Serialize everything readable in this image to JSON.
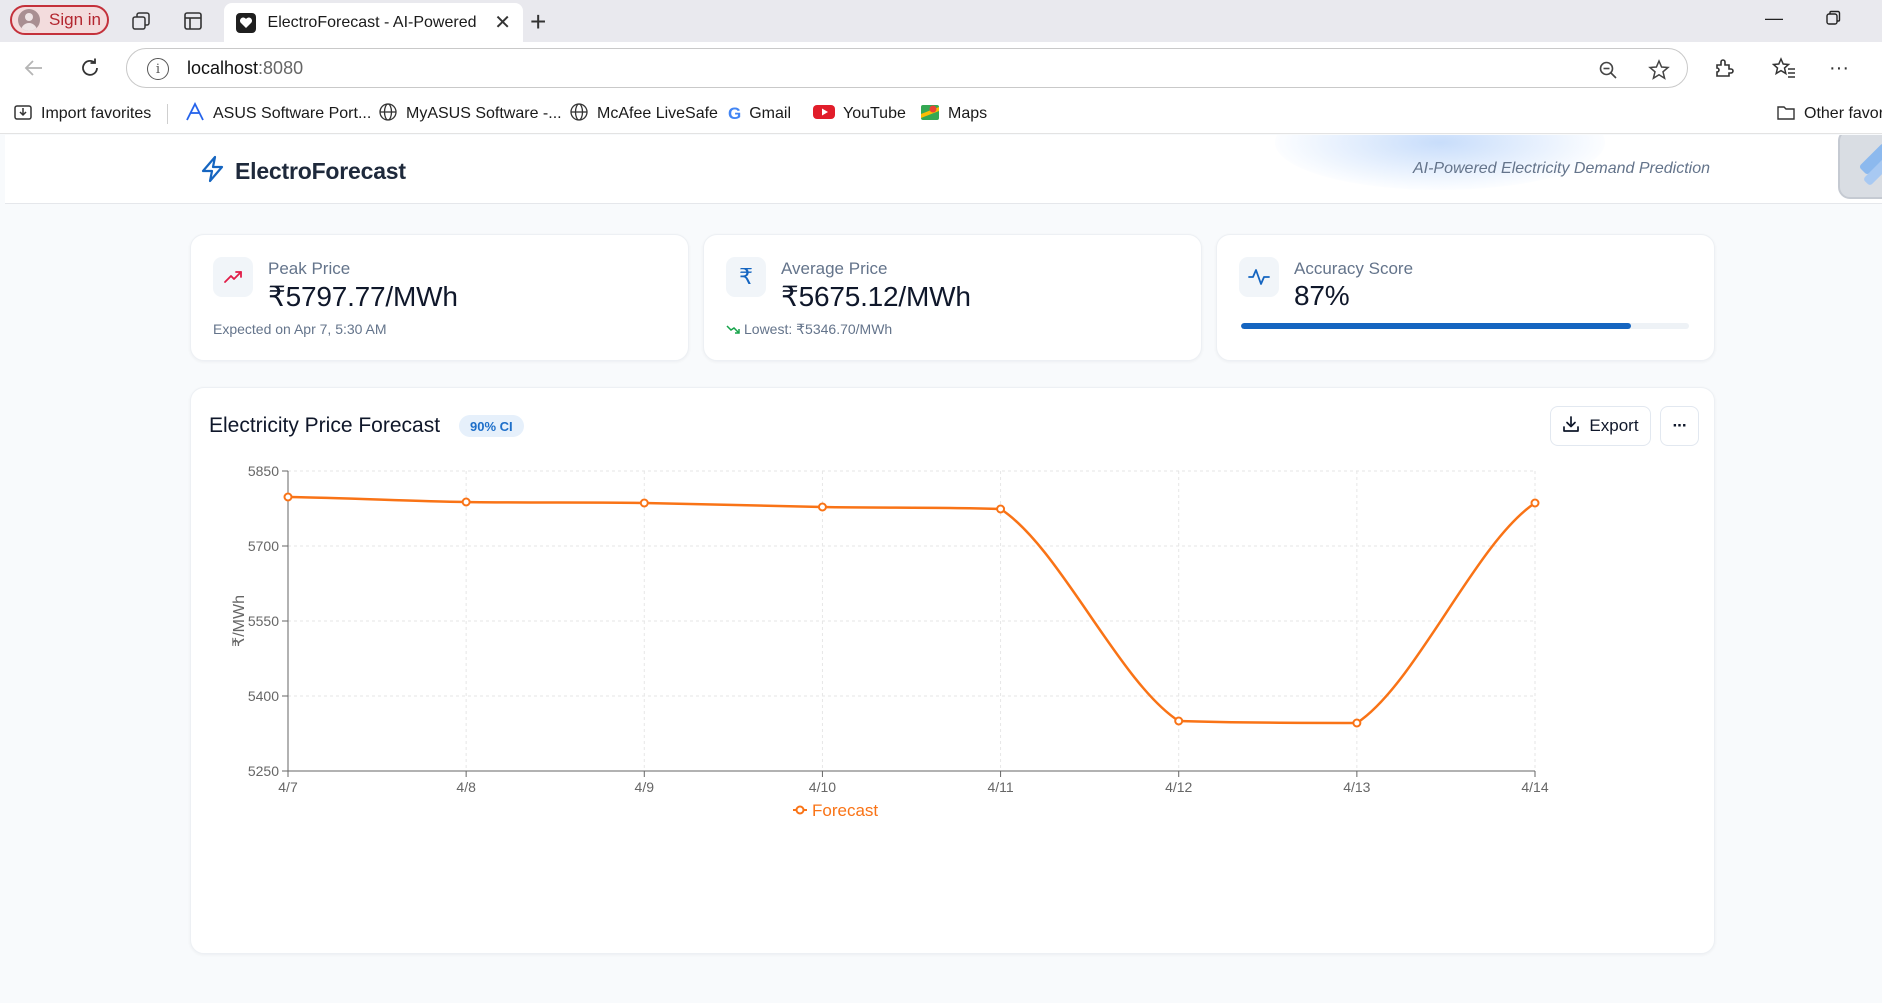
{
  "browser": {
    "signin_label": "Sign in",
    "tab_title": "ElectroForecast - AI-Powered Electricity Demand Prediction",
    "url_host": "localhost",
    "url_port": ":8080"
  },
  "bookmarks": [
    {
      "label": "Import favorites",
      "icon": "import-icon"
    },
    {
      "label": "ASUS Software Port...",
      "icon": "asus-icon"
    },
    {
      "label": "MyASUS Software -...",
      "icon": "globe-icon"
    },
    {
      "label": "McAfee LiveSafe",
      "icon": "globe-icon"
    },
    {
      "label": "Gmail",
      "icon": "google-icon"
    },
    {
      "label": "YouTube",
      "icon": "youtube-icon"
    },
    {
      "label": "Maps",
      "icon": "maps-icon"
    },
    {
      "label": "Other favori",
      "icon": "folder-icon"
    }
  ],
  "app": {
    "brand": "ElectroForecast",
    "tagline": "AI-Powered Electricity Demand Prediction"
  },
  "stats": {
    "peak": {
      "label": "Peak Price",
      "value": "₹5797.77/MWh",
      "sub": "Expected on Apr 7, 5:30 AM"
    },
    "average": {
      "label": "Average Price",
      "value": "₹5675.12/MWh",
      "sub": "Lowest: ₹5346.70/MWh"
    },
    "accuracy": {
      "label": "Accuracy Score",
      "value": "87%",
      "progress": 0.87
    }
  },
  "chart_panel": {
    "title": "Electricity Price Forecast",
    "badge": "90% CI",
    "export_label": "Export",
    "more_label": "···"
  },
  "colors": {
    "accent": "#1565c0",
    "series": "#f97316",
    "peak_icon": "#e11d48",
    "lowest_arrow": "#16a34a"
  },
  "chart_data": {
    "type": "line",
    "x": [
      "4/7",
      "4/8",
      "4/9",
      "4/10",
      "4/11",
      "4/12",
      "4/13",
      "4/14"
    ],
    "series": [
      {
        "name": "Forecast",
        "values": [
          5798,
          5788,
          5786,
          5778,
          5774,
          5350,
          5346,
          5786
        ]
      }
    ],
    "ylabel": "₹/MWh",
    "ylim": [
      5250,
      5850
    ],
    "yticks": [
      5250,
      5400,
      5550,
      5700,
      5850
    ],
    "grid": true,
    "legend": "bottom-center"
  }
}
